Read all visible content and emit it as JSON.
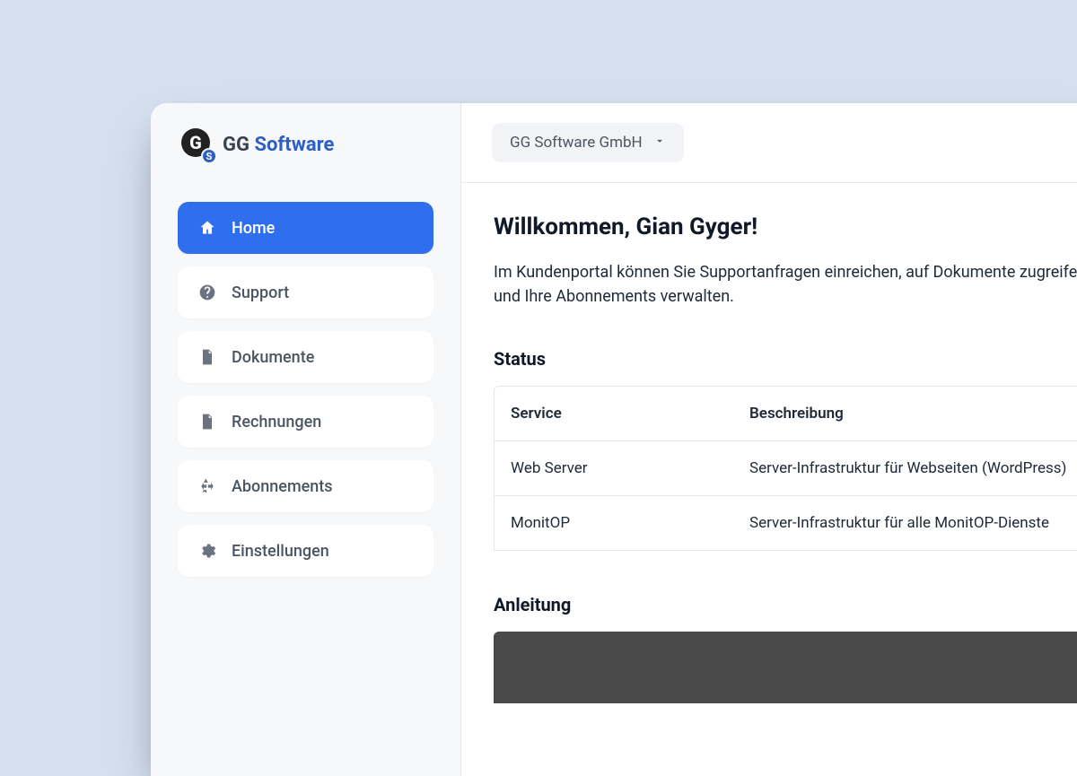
{
  "brand": {
    "name_primary": "GG",
    "name_accent": "Software",
    "mark_big": "G",
    "mark_small": "S"
  },
  "sidebar": {
    "items": [
      {
        "label": "Home",
        "icon": "home-icon",
        "active": true
      },
      {
        "label": "Support",
        "icon": "help-icon",
        "active": false
      },
      {
        "label": "Dokumente",
        "icon": "document-icon",
        "active": false
      },
      {
        "label": "Rechnungen",
        "icon": "invoice-icon",
        "active": false
      },
      {
        "label": "Abonnements",
        "icon": "recycle-icon",
        "active": false
      },
      {
        "label": "Einstellungen",
        "icon": "gear-icon",
        "active": false
      }
    ]
  },
  "topbar": {
    "org_name": "GG Software GmbH"
  },
  "main": {
    "welcome_title": "Willkommen, Gian Gyger!",
    "welcome_sub": "Im Kundenportal können Sie Supportanfragen einreichen, auf Dokumente zugreifen und Ihre Abonnements verwalten.",
    "status_heading": "Status",
    "status_table": {
      "headers": {
        "service": "Service",
        "description": "Beschreibung"
      },
      "rows": [
        {
          "service": "Web Server",
          "description": "Server-Infrastruktur für Webseiten (WordPress)"
        },
        {
          "service": "MonitOP",
          "description": "Server-Infrastruktur für alle MonitOP-Dienste"
        }
      ]
    },
    "guide_heading": "Anleitung"
  }
}
